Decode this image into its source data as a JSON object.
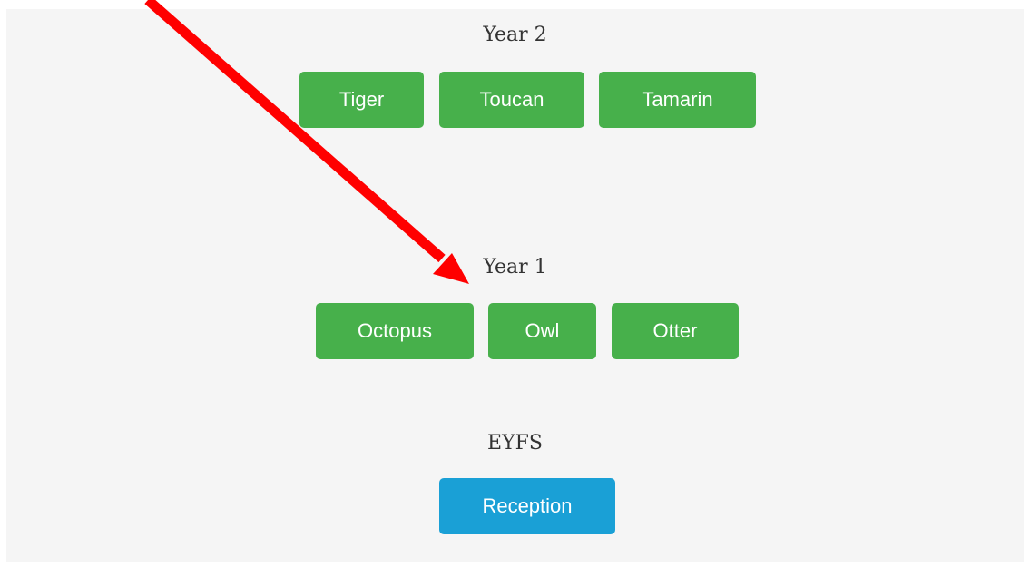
{
  "groups": [
    {
      "title": "Year 2",
      "classes": [
        "Tiger",
        "Toucan",
        "Tamarin"
      ]
    },
    {
      "title": "Year 1",
      "classes": [
        "Octopus",
        "Owl",
        "Otter"
      ]
    },
    {
      "title": "EYFS",
      "classes": [
        "Reception"
      ]
    }
  ],
  "colors": {
    "panel_background": "#f5f5f5",
    "button_green": "#47b04b",
    "button_blue": "#1aa0d6",
    "annotation_arrow": "#ff0000"
  },
  "annotation": {
    "type": "arrow",
    "points_to": "Owl"
  }
}
